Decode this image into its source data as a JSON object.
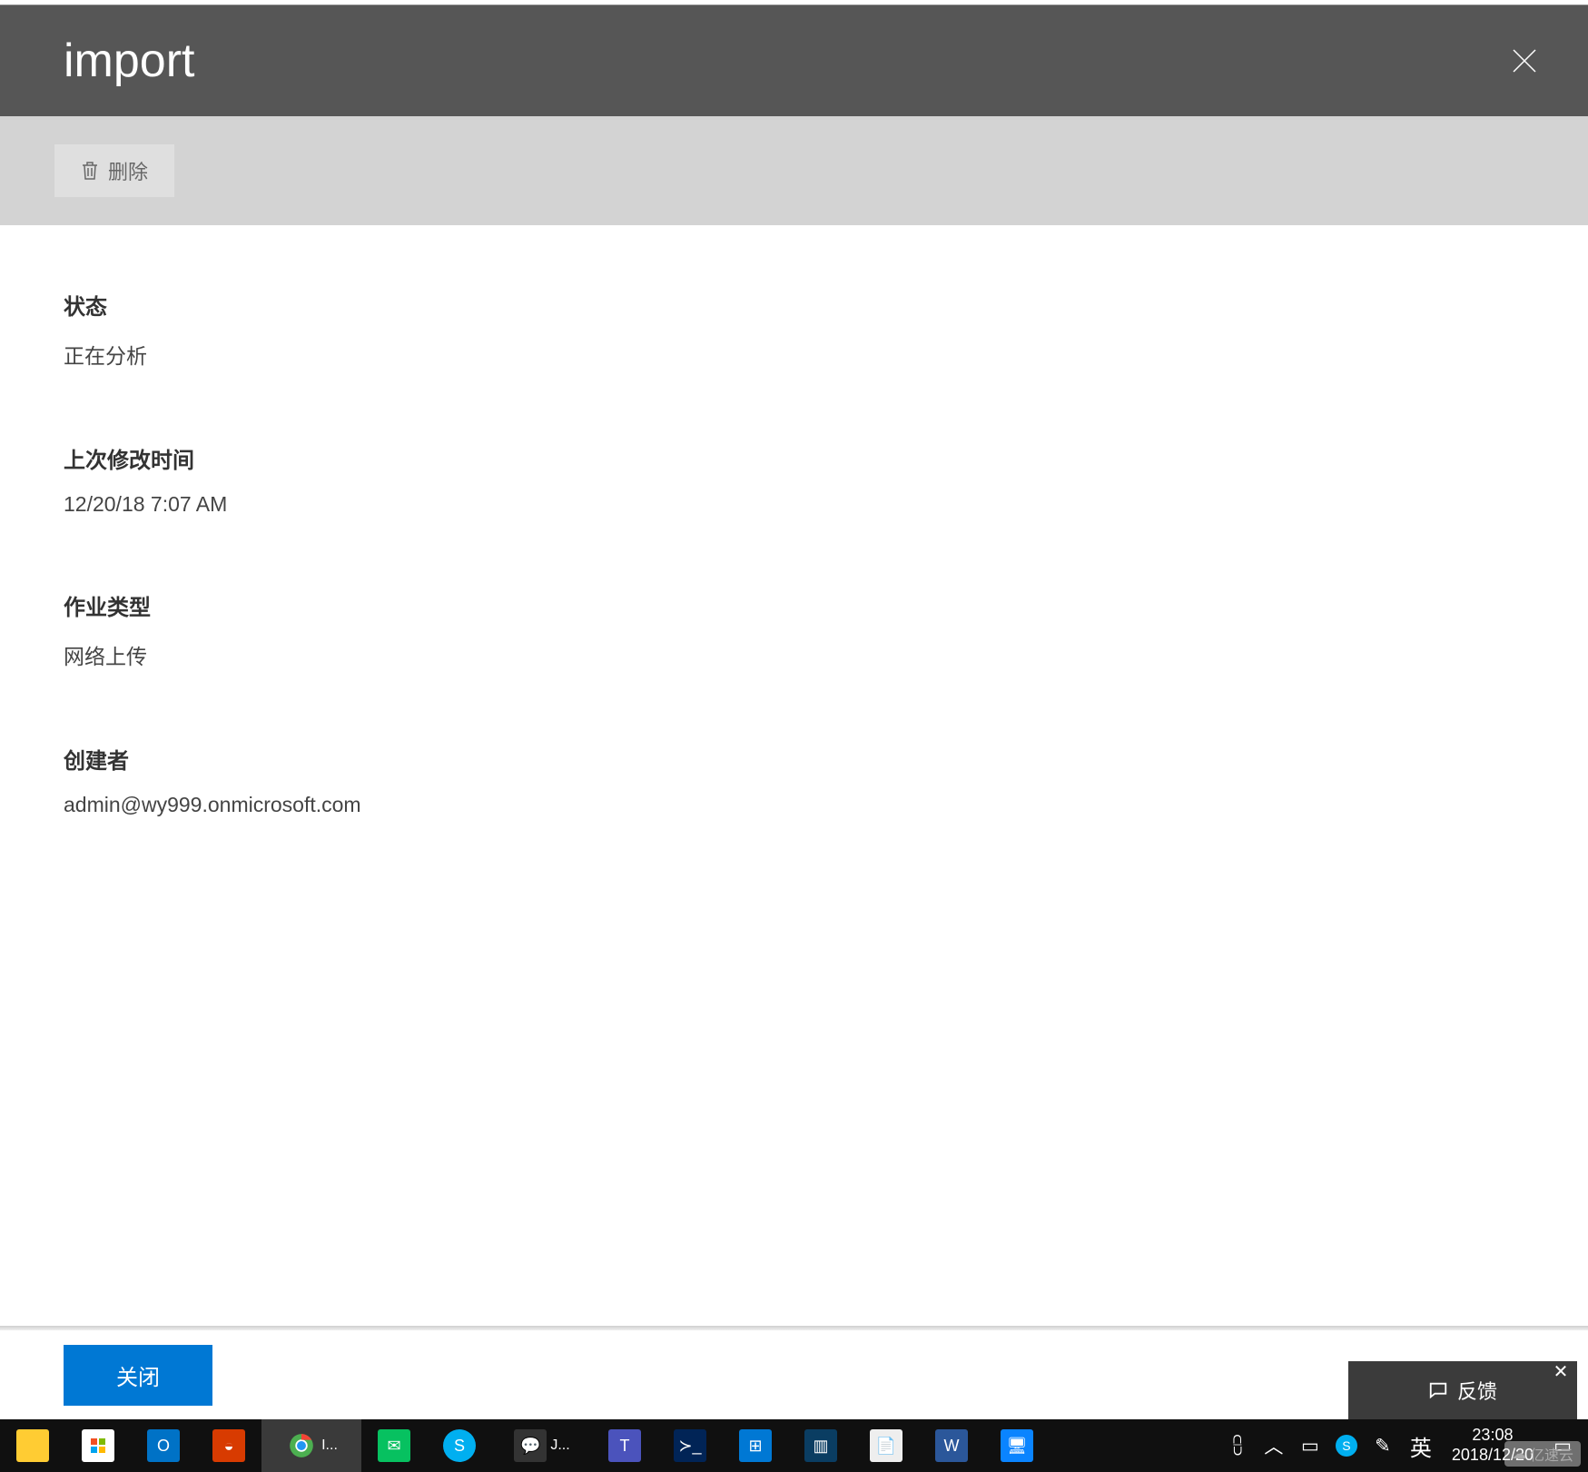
{
  "header": {
    "title": "import"
  },
  "toolbar": {
    "delete_label": "删除"
  },
  "fields": {
    "status_label": "状态",
    "status_value": "正在分析",
    "last_modified_label": "上次修改时间",
    "last_modified_value": "12/20/18 7:07 AM",
    "job_type_label": "作业类型",
    "job_type_value": "网络上传",
    "created_by_label": "创建者",
    "created_by_value": "admin@wy999.onmicrosoft.com"
  },
  "footer": {
    "close_label": "关闭"
  },
  "feedback": {
    "label": "反馈"
  },
  "taskbar": {
    "chrome_label": "I...",
    "jabber_label": "J...",
    "ime_label": "英",
    "clock_time": "23:08",
    "clock_date": "2018/12/20"
  },
  "watermark": "亿速云"
}
